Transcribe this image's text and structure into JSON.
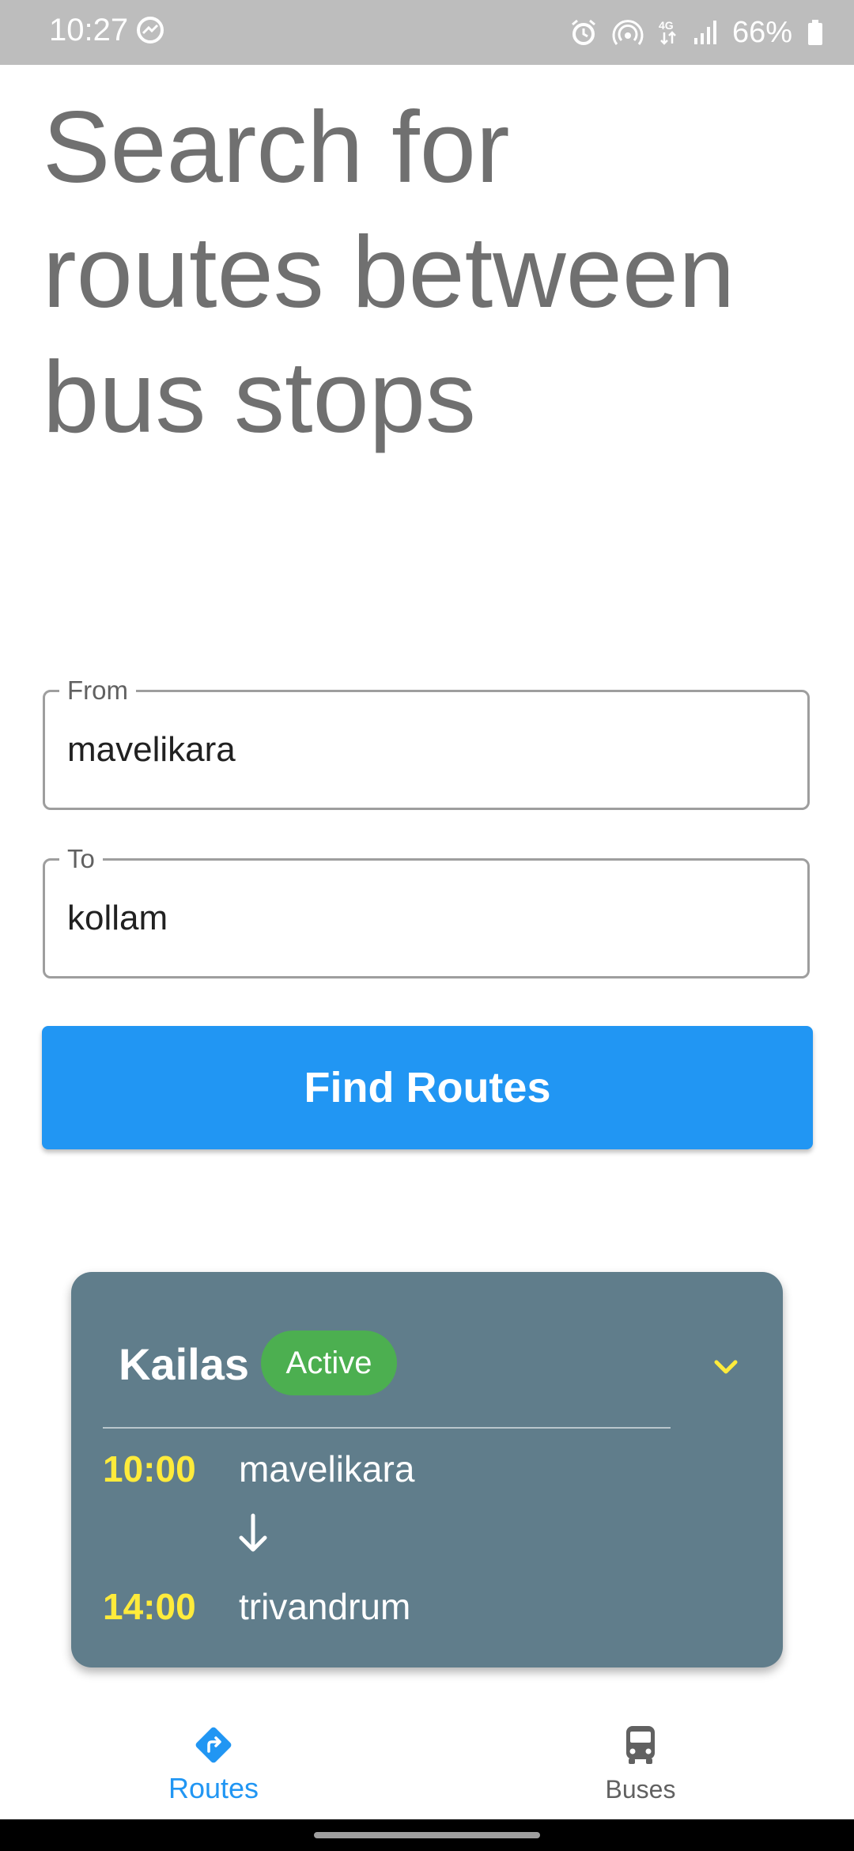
{
  "status_bar": {
    "time": "10:27",
    "battery": "66%",
    "icons": [
      "messenger-icon",
      "alarm-icon",
      "hotspot-icon",
      "4g-icon",
      "signal-icon",
      "battery-icon"
    ]
  },
  "headline": "Search for routes between bus stops",
  "form": {
    "from_label": "From",
    "from_value": "mavelikara",
    "to_label": "To",
    "to_value": "kollam",
    "submit_label": "Find Routes"
  },
  "route_card": {
    "bus_name": "Kailas",
    "status": "Active",
    "departure_time": "10:00",
    "departure_stop": "mavelikara",
    "arrival_time": "14:00",
    "arrival_stop": "trivandrum"
  },
  "bottom_nav": {
    "items": [
      {
        "label": "Routes",
        "icon": "directions-icon",
        "active": true
      },
      {
        "label": "Buses",
        "icon": "bus-icon",
        "active": false
      }
    ]
  },
  "colors": {
    "primary": "#2196f3",
    "card": "#607d8b",
    "active_badge": "#4caf50",
    "time_accent": "#ffeb3b",
    "headline": "#707070"
  }
}
